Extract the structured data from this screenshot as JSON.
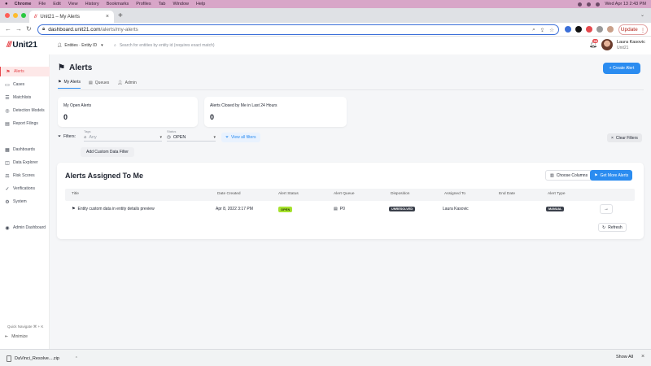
{
  "menubar": {
    "app": "Chrome",
    "items": [
      "File",
      "Edit",
      "View",
      "History",
      "Bookmarks",
      "Profiles",
      "Tab",
      "Window",
      "Help"
    ],
    "clock": "Wed Apr 13  2:43 PM"
  },
  "browser": {
    "tab_title": "Unit21 – My Alerts",
    "url_host": "dashboard.unit21.com",
    "url_path": "/alerts/my-alerts",
    "update_label": "Update",
    "colors": {
      "close": "#ff5f57",
      "minimize": "#febc2e",
      "zoom": "#28c840"
    }
  },
  "header": {
    "logo_mark": "///",
    "logo_text": "Unit21",
    "entity_select": "Entities · Entity ID",
    "search_placeholder": "Search for entities by entity id (requires exact match)",
    "notif_count": "99",
    "user_name": "Laura Kasovic",
    "user_org": "Unit21"
  },
  "sidebar": {
    "items": [
      {
        "label": "Alerts",
        "icon": "flag-icon",
        "glyph": "⚑"
      },
      {
        "label": "Cases",
        "icon": "briefcase-icon",
        "glyph": "▭"
      },
      {
        "label": "Matchlists",
        "icon": "list-icon",
        "glyph": "☰"
      },
      {
        "label": "Detection Models",
        "icon": "model-icon",
        "glyph": "◎"
      },
      {
        "label": "Report Filings",
        "icon": "document-icon",
        "glyph": "▤"
      },
      {
        "label": "Dashboards",
        "icon": "chart-icon",
        "glyph": "▦"
      },
      {
        "label": "Data Explorer",
        "icon": "explorer-icon",
        "glyph": "◫"
      },
      {
        "label": "Risk Scores",
        "icon": "risk-icon",
        "glyph": "⚖"
      },
      {
        "label": "Verifications",
        "icon": "verify-icon",
        "glyph": "✓"
      },
      {
        "label": "System",
        "icon": "system-icon",
        "glyph": "⚙"
      },
      {
        "label": "Admin Dashboard",
        "icon": "admin-icon",
        "glyph": "◉"
      }
    ],
    "quick_nav": "Quick Navigate ⌘ + K",
    "minimize": "Minimize"
  },
  "main": {
    "title": "Alerts",
    "create_button": "+ Create Alert",
    "tabs": [
      "My Alerts",
      "Queues",
      "Admin"
    ],
    "stats": [
      {
        "label": "My Open Alerts",
        "value": "0"
      },
      {
        "label": "Alerts Closed by Me in Last 24 Hours",
        "value": "0"
      }
    ],
    "filters": {
      "label": "Filters:",
      "tags_caption": "Tags",
      "tags_value": "Any",
      "status_caption": "Status",
      "status_value": "OPEN",
      "view_all": "View all filters",
      "clear": "Clear Filters",
      "add_custom": "Add Custom Data Filter"
    },
    "assigned": {
      "title": "Alerts Assigned To Me",
      "choose_columns": "Choose Columns",
      "get_more": "Get More Alerts",
      "columns": [
        "Title",
        "Date Created",
        "Alert Status",
        "Alert Queue",
        "Disposition",
        "Assigned To",
        "End Date",
        "Alert Type"
      ],
      "rows": [
        {
          "title": "Entity custom data in entity details preview",
          "date": "Apr 8, 2022 3:17 PM",
          "status": "OPEN",
          "queue": "P0",
          "disposition": "UNRESOLVED",
          "assigned": "Laura Kasovic",
          "end_date": "",
          "type": "MANUAL"
        }
      ],
      "refresh": "Refresh"
    }
  },
  "downloads": {
    "file": "DaVinci_Resolve....zip",
    "show_all": "Show All"
  }
}
